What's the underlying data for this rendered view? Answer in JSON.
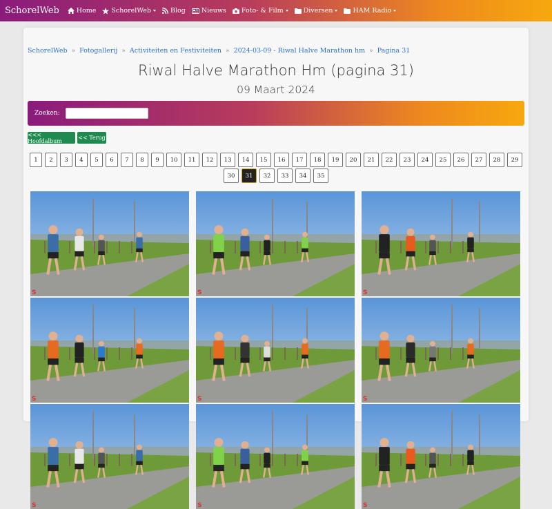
{
  "navbar": {
    "brand": "SchorelWeb",
    "items": [
      {
        "label": "Home",
        "icon": "home-icon",
        "dropdown": false
      },
      {
        "label": "SchorelWeb",
        "icon": "star-icon",
        "dropdown": true
      },
      {
        "label": "Blog",
        "icon": "rss-icon",
        "dropdown": false
      },
      {
        "label": "Nieuws",
        "icon": "newspaper-icon",
        "dropdown": false
      },
      {
        "label": "Foto- & Film",
        "icon": "camera-icon",
        "dropdown": true
      },
      {
        "label": "Diversen",
        "icon": "folder-icon",
        "dropdown": true
      },
      {
        "label": "HAM Radio",
        "icon": "folder-icon",
        "dropdown": true
      }
    ]
  },
  "breadcrumb": [
    "SchorelWeb",
    "Fotogallerij",
    "Activiteiten en Festiviteiten",
    "2024-03-09 - Riwal Halve Marathon hm",
    "Pagina 31"
  ],
  "page": {
    "title": "Riwal Halve Marathon Hm (pagina 31)",
    "subtitle": "09 Maart 2024"
  },
  "search": {
    "label": "Zoeken:",
    "value": "",
    "placeholder": ""
  },
  "buttons": {
    "main_album": "<<< Hoofdalbum",
    "back": "<< Terug"
  },
  "pagination": {
    "pages": [
      "1",
      "2",
      "3",
      "4",
      "5",
      "6",
      "7",
      "8",
      "9",
      "10",
      "11",
      "12",
      "13",
      "14",
      "15",
      "16",
      "17",
      "18",
      "19",
      "20",
      "21",
      "22",
      "23",
      "24",
      "25",
      "26",
      "27",
      "28",
      "29",
      "30",
      "31",
      "32",
      "33",
      "34",
      "35"
    ],
    "current": "31"
  },
  "colors": {
    "gradient_start": "#8a1b7c",
    "gradient_end": "#f7a80e",
    "link": "#2c6fd6",
    "button_green": "#1e8a4f"
  }
}
